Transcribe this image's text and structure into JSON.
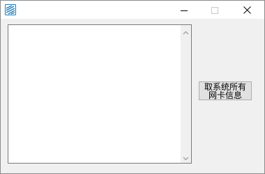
{
  "window": {
    "title": "",
    "app_icon": "app-logo-icon",
    "controls": {
      "minimize_icon": "minimize-icon",
      "maximize_icon": "maximize-icon",
      "close_icon": "close-icon"
    }
  },
  "main": {
    "listbox": {
      "items": [],
      "scroll_up_icon": "scroll-up-arrow-icon",
      "scroll_down_icon": "scroll-down-arrow-icon"
    },
    "action_button": {
      "label": "取系统所有网卡信息"
    }
  },
  "colors": {
    "titlebar_bg": "#ffffff",
    "client_bg": "#f0f0f0",
    "button_bg": "#e1e1e1",
    "icon_accent": "#1e7bb8"
  }
}
